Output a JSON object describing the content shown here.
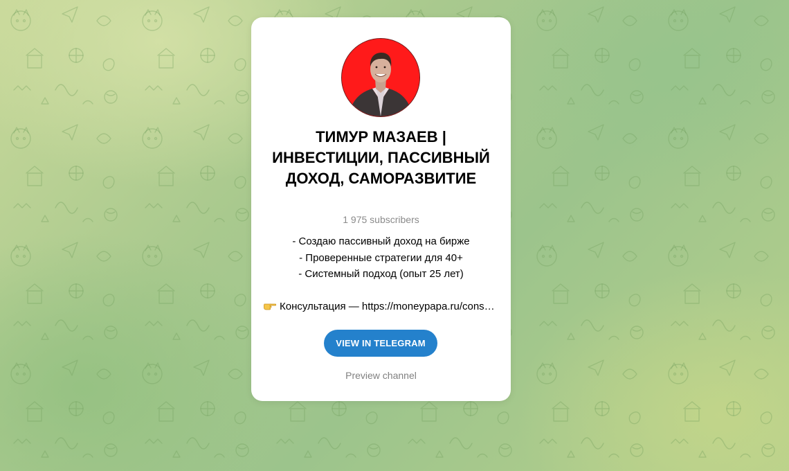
{
  "channel": {
    "title": "ТИМУР МАЗАЕВ | ИНВЕСТИЦИИ, ПАССИВНЫЙ ДОХОД, САМОРАЗВИТИЕ",
    "subscribers": "1 975 subscribers",
    "description_lines": [
      "- Создаю пассивный доход на бирже",
      "- Проверенные стратегии для 40+",
      "- Системный подход (опыт 25 лет)"
    ],
    "consult_label": "Консультация — https://moneypapa.ru/consultation",
    "consult_icon": "pointing-hand-emoji"
  },
  "actions": {
    "view_label": "VIEW IN TELEGRAM",
    "preview_label": "Preview channel"
  },
  "colors": {
    "accent": "#2481cc",
    "avatar_bg": "#ff1a1a",
    "muted_text": "#8a8a8a"
  }
}
